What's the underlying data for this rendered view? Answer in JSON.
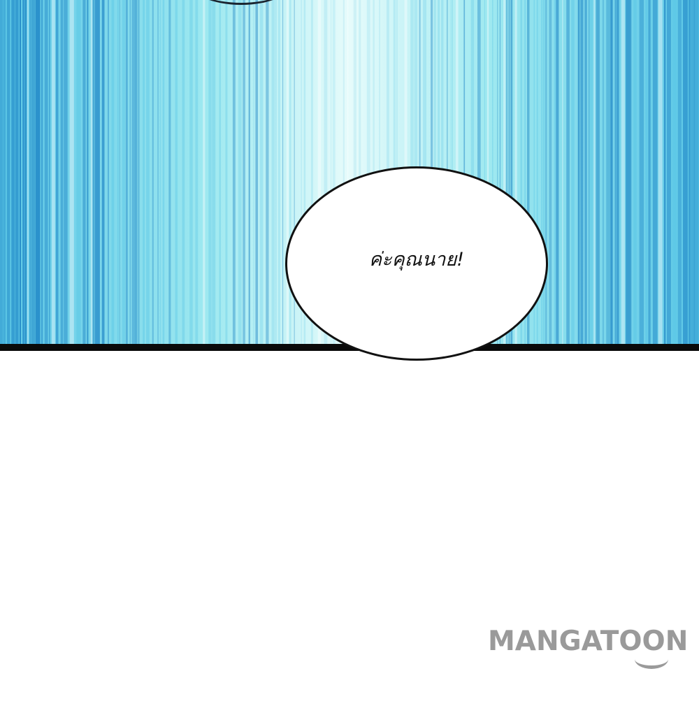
{
  "panel": {
    "background_colors": [
      "#1f86c6",
      "#5cc7e6",
      "#9fe9f0",
      "#e6fbfb"
    ]
  },
  "speech_bubble": {
    "text": "ค่ะคุณนาย!"
  },
  "watermark": {
    "text": "MANGATOON",
    "color": "#9a9a9a"
  }
}
